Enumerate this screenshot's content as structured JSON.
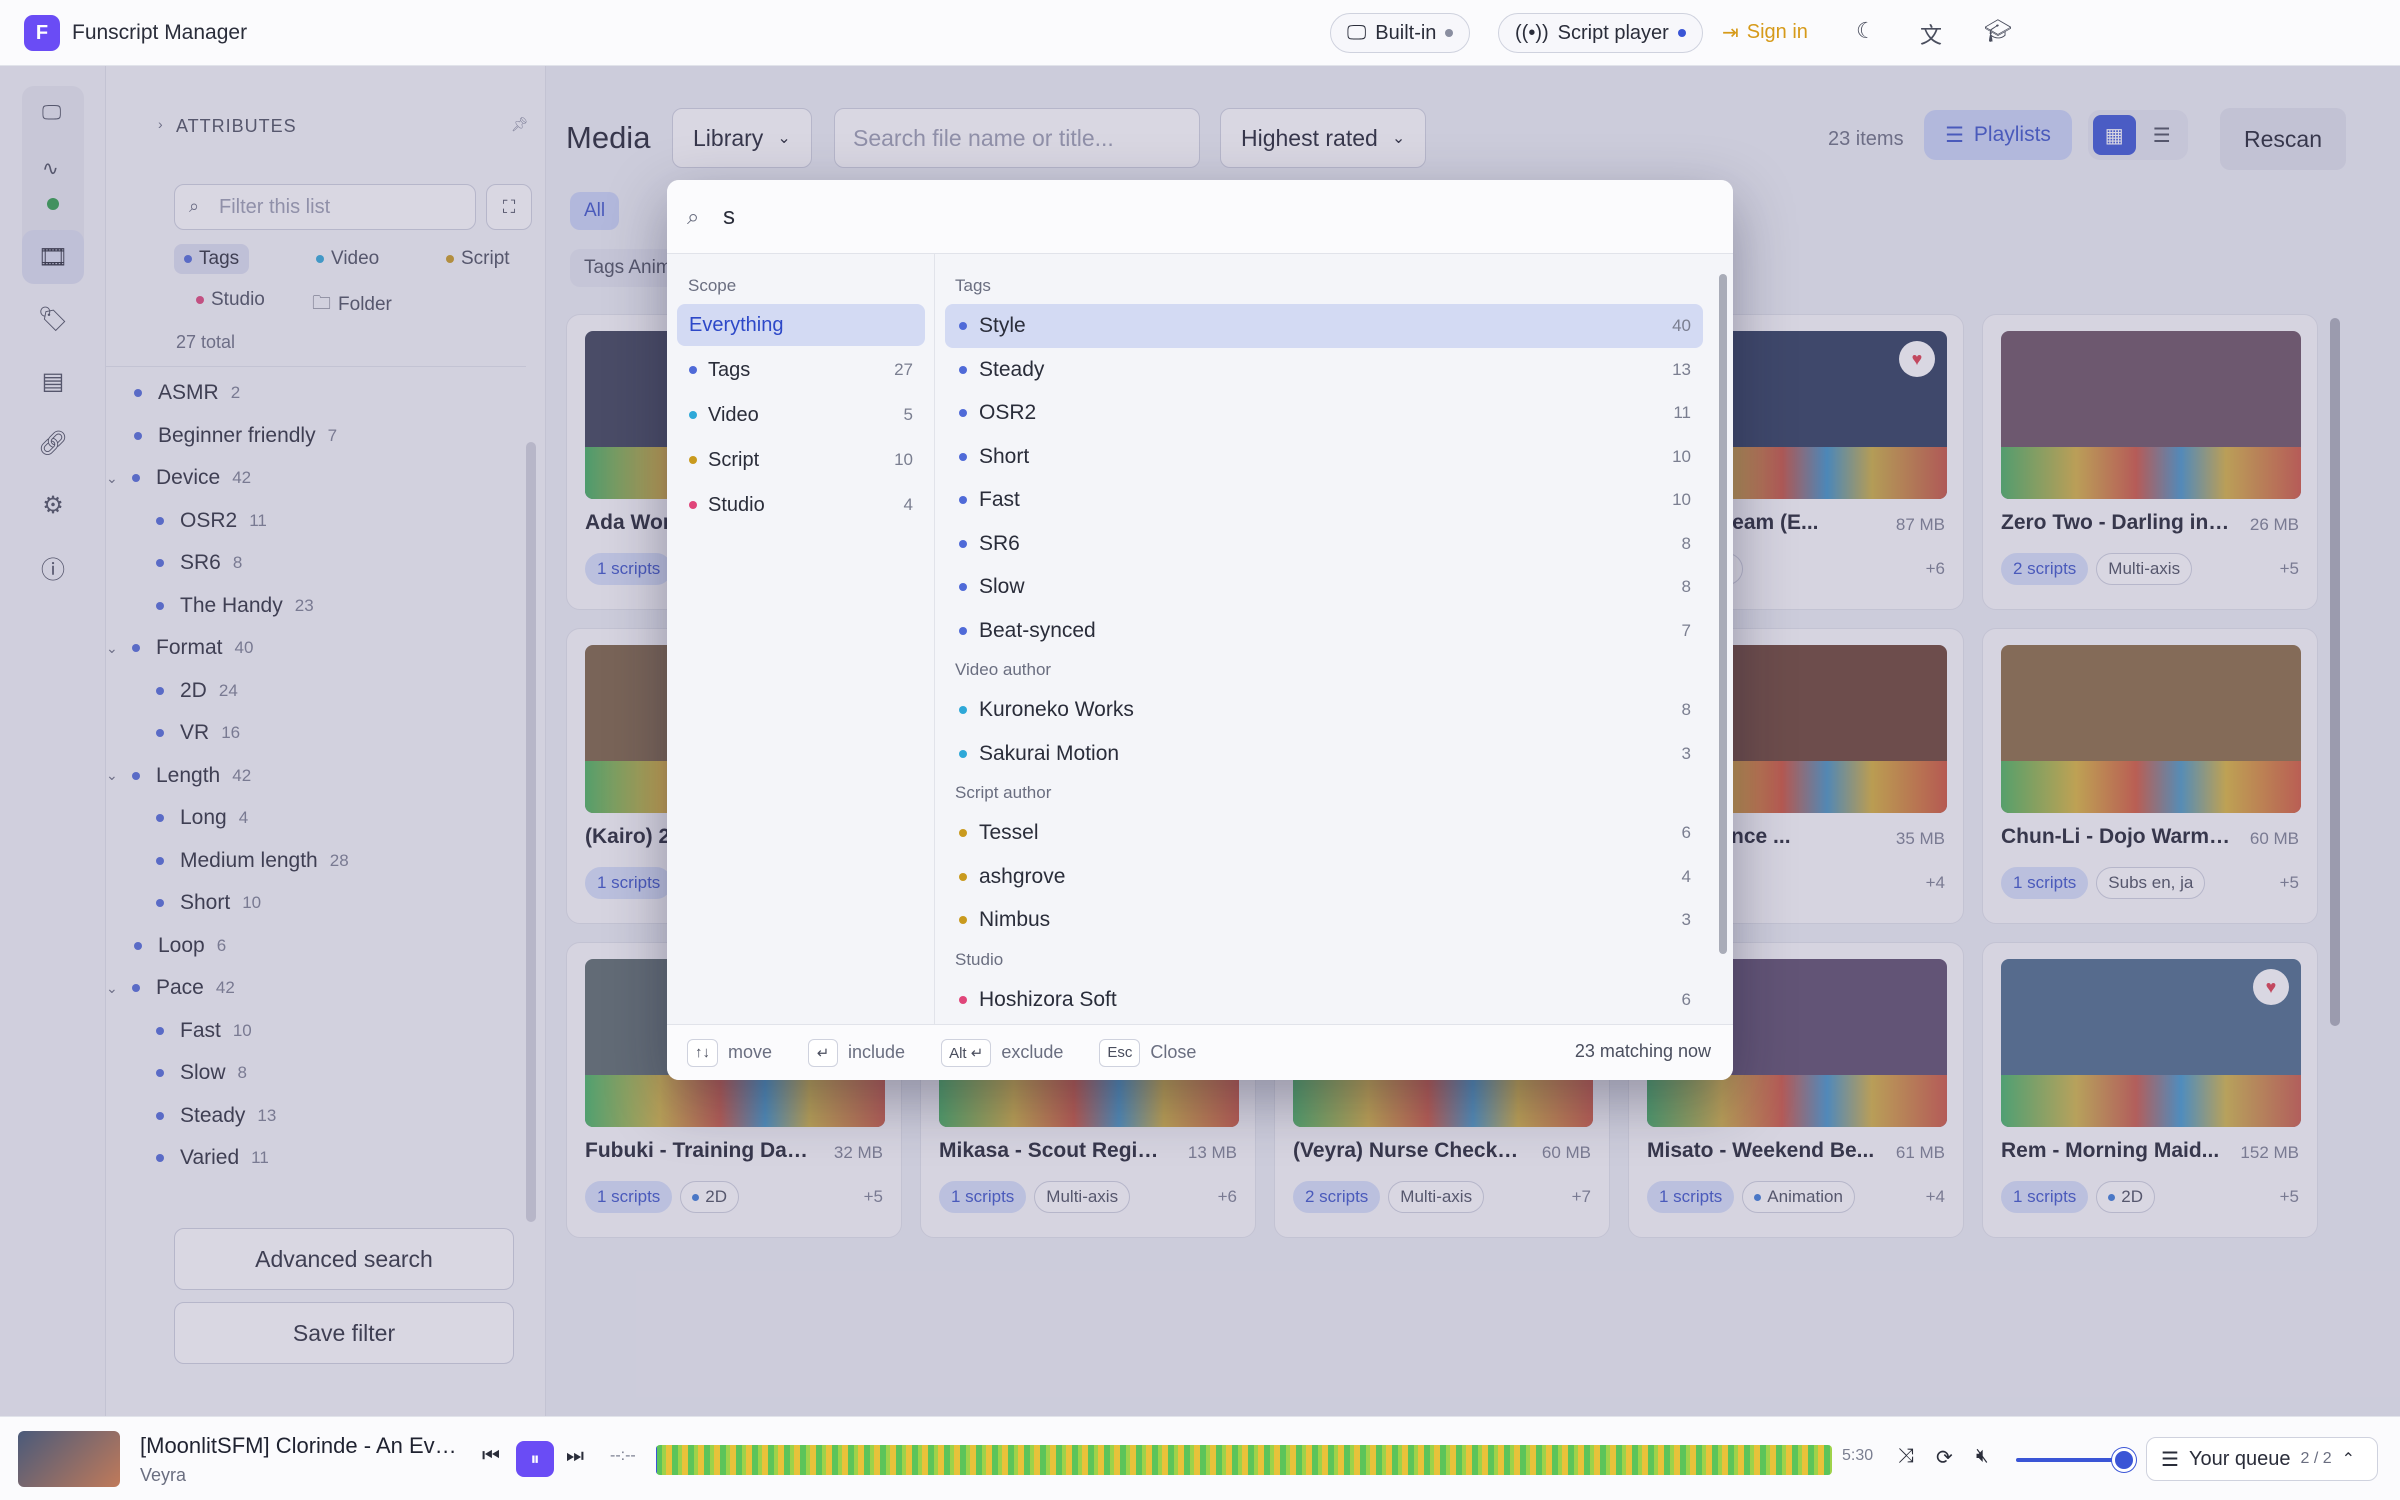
{
  "titlebar": {
    "app_title": "Funscript Manager",
    "logo_letter": "F",
    "builtin_label": "Built-in",
    "script_player_label": "Script player",
    "signin_label": "Sign in"
  },
  "sidebar": {
    "attributes_heading": "ATTRIBUTES",
    "filter_placeholder": "Filter this list",
    "categories": [
      {
        "label": "Tags",
        "color": "#4f6ad8"
      },
      {
        "label": "Video",
        "color": "#2ea8d8"
      },
      {
        "label": "Script",
        "color": "#c99a1e"
      },
      {
        "label": "Studio",
        "color": "#e0457a"
      },
      {
        "label": "Folder",
        "color": "#6a6e80"
      }
    ],
    "total": "27 total",
    "tree": [
      {
        "label": "ASMR",
        "count": "2",
        "level": 0
      },
      {
        "label": "Beginner friendly",
        "count": "7",
        "level": 0
      },
      {
        "label": "Device",
        "count": "42",
        "level": 0,
        "expanded": true
      },
      {
        "label": "OSR2",
        "count": "11",
        "level": 1
      },
      {
        "label": "SR6",
        "count": "8",
        "level": 1
      },
      {
        "label": "The Handy",
        "count": "23",
        "level": 1
      },
      {
        "label": "Format",
        "count": "40",
        "level": 0,
        "expanded": true
      },
      {
        "label": "2D",
        "count": "24",
        "level": 1
      },
      {
        "label": "VR",
        "count": "16",
        "level": 1
      },
      {
        "label": "Length",
        "count": "42",
        "level": 0,
        "expanded": true
      },
      {
        "label": "Long",
        "count": "4",
        "level": 1
      },
      {
        "label": "Medium length",
        "count": "28",
        "level": 1
      },
      {
        "label": "Short",
        "count": "10",
        "level": 1
      },
      {
        "label": "Loop",
        "count": "6",
        "level": 0
      },
      {
        "label": "Pace",
        "count": "42",
        "level": 0,
        "expanded": true
      },
      {
        "label": "Fast",
        "count": "10",
        "level": 1
      },
      {
        "label": "Slow",
        "count": "8",
        "level": 1
      },
      {
        "label": "Steady",
        "count": "13",
        "level": 1
      },
      {
        "label": "Varied",
        "count": "11",
        "level": 1
      }
    ],
    "advanced_search_label": "Advanced search",
    "save_filter_label": "Save filter"
  },
  "main": {
    "title": "Media",
    "library_select": "Library",
    "search_placeholder": "Search file name or title...",
    "sort_select": "Highest rated",
    "item_count": "23 items",
    "playlists_label": "Playlists",
    "rescan_label": "Rescan",
    "all_chip": "All",
    "tag_chip": "Tags Anim"
  },
  "cards": [
    {
      "title": "Ada Wong",
      "size": "",
      "tags": [
        "1 scripts"
      ],
      "more": "",
      "heart": false,
      "thumb": "#3a3f55"
    },
    {
      "title": "Moon Dream (E...",
      "size": "87 MB",
      "tags": [
        "Multi-axis"
      ],
      "more": "+6",
      "heart": true,
      "thumb": "#2a3a5a"
    },
    {
      "title": "Zero Two - Darling in ...",
      "size": "26 MB",
      "tags": [
        "2 scripts",
        "Multi-axis"
      ],
      "more": "+5",
      "heart": false,
      "thumb": "#6a5060"
    },
    {
      "title": "(Kairo) 2",
      "size": "",
      "tags": [
        "1 scripts"
      ],
      "more": "",
      "heart": false,
      "thumb": "#7a6040"
    },
    {
      "title": "- Obedience ...",
      "size": "35 MB",
      "tags": [
        "2D"
      ],
      "more": "+4",
      "heart": false,
      "thumb": "#6a4030"
    },
    {
      "title": "Chun-Li - Dojo Warm-...",
      "size": "60 MB",
      "tags": [
        "1 scripts",
        "Subs en, ja"
      ],
      "more": "+5",
      "heart": false,
      "thumb": "#8a6a40"
    },
    {
      "title": "Fubuki - Training Day ...",
      "size": "32 MB",
      "tags": [
        "1 scripts",
        "2D"
      ],
      "more": "+5",
      "heart": false,
      "thumb": "#5a6a6a"
    },
    {
      "title": "Mikasa - Scout Regim...",
      "size": "13 MB",
      "tags": [
        "1 scripts",
        "Multi-axis"
      ],
      "more": "+6",
      "heart": false,
      "thumb": "#6a5a4a"
    },
    {
      "title": "(Veyra) Nurse Checku...",
      "size": "60 MB",
      "tags": [
        "2 scripts",
        "Multi-axis"
      ],
      "more": "+7",
      "heart": false,
      "thumb": "#7a6a5a"
    },
    {
      "title": "Misato - Weekend Be...",
      "size": "61 MB",
      "tags": [
        "1 scripts",
        "Animation"
      ],
      "more": "+4",
      "heart": false,
      "thumb": "#5a4a6a"
    },
    {
      "title": "Rem - Morning Maid...",
      "size": "152 MB",
      "tags": [
        "1 scripts",
        "2D"
      ],
      "more": "+5",
      "heart": true,
      "thumb": "#4a6a8a"
    }
  ],
  "palette": {
    "query": "s",
    "scope_heading": "Scope",
    "scopes": [
      {
        "label": "Everything",
        "count": "",
        "color": ""
      },
      {
        "label": "Tags",
        "count": "27",
        "color": "#4f6ad8"
      },
      {
        "label": "Video",
        "count": "5",
        "color": "#2ea8d8"
      },
      {
        "label": "Script",
        "count": "10",
        "color": "#c99a1e"
      },
      {
        "label": "Studio",
        "count": "4",
        "color": "#e0457a"
      }
    ],
    "groups": [
      {
        "heading": "Tags",
        "color": "#4f6ad8",
        "items": [
          {
            "label": "Style",
            "count": "40"
          },
          {
            "label": "Steady",
            "count": "13"
          },
          {
            "label": "OSR2",
            "count": "11"
          },
          {
            "label": "Short",
            "count": "10"
          },
          {
            "label": "Fast",
            "count": "10"
          },
          {
            "label": "SR6",
            "count": "8"
          },
          {
            "label": "Slow",
            "count": "8"
          },
          {
            "label": "Beat-synced",
            "count": "7"
          }
        ]
      },
      {
        "heading": "Video author",
        "color": "#2ea8d8",
        "items": [
          {
            "label": "Kuroneko Works",
            "count": "8"
          },
          {
            "label": "Sakurai Motion",
            "count": "3"
          }
        ]
      },
      {
        "heading": "Script author",
        "color": "#c99a1e",
        "items": [
          {
            "label": "Tessel",
            "count": "6"
          },
          {
            "label": "ashgrove",
            "count": "4"
          },
          {
            "label": "Nimbus",
            "count": "3"
          }
        ]
      },
      {
        "heading": "Studio",
        "color": "#e0457a",
        "items": [
          {
            "label": "Hoshizora Soft",
            "count": "6"
          }
        ]
      }
    ],
    "footer": {
      "move_key": "↑↓",
      "move_label": "move",
      "include_key": "↵",
      "include_label": "include",
      "exclude_key": "Alt ↵",
      "exclude_label": "exclude",
      "close_key": "Esc",
      "close_label": "Close",
      "matching": "23 matching now"
    }
  },
  "player": {
    "title": "[MoonlitSFM] Clorinde - An Eve...",
    "subtitle": "Veyra",
    "elapsed": "--:--",
    "duration": "5:30",
    "queue_label": "Your queue",
    "queue_position": "2 / 2",
    "volume_fraction": 0.83
  },
  "colors": {
    "accent": "#3a55d6",
    "brand": "#6a4cf5",
    "signin": "#d69a19",
    "heart": "#e03a4a"
  }
}
